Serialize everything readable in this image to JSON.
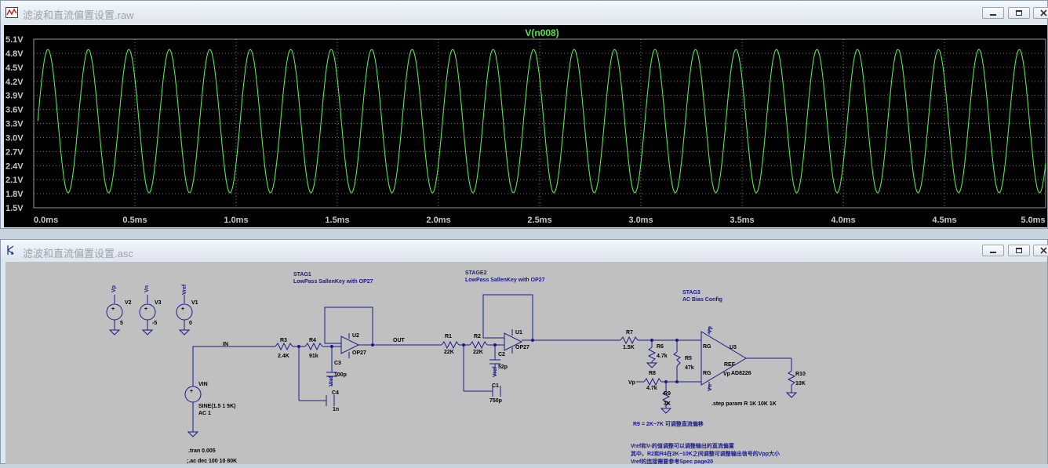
{
  "plot_window": {
    "title": "滤波和直流偏置设置.raw"
  },
  "schematic_window": {
    "title": "滤波和直流偏置设置.asc"
  },
  "chart_data": {
    "type": "line",
    "title": "V(n008)",
    "xlabel": "",
    "ylabel": "",
    "xlim": [
      0,
      5.0
    ],
    "ylim": [
      1.5,
      5.1
    ],
    "x_ticks": [
      "0.0ms",
      "0.5ms",
      "1.0ms",
      "1.5ms",
      "2.0ms",
      "2.5ms",
      "3.0ms",
      "3.5ms",
      "4.0ms",
      "4.5ms",
      "5.0ms"
    ],
    "y_ticks": [
      "5.1V",
      "4.8V",
      "4.5V",
      "4.2V",
      "3.9V",
      "3.6V",
      "3.3V",
      "3.0V",
      "2.7V",
      "2.4V",
      "2.1V",
      "1.8V",
      "1.5V"
    ],
    "grid": true,
    "series": [
      {
        "name": "V(n008)",
        "color": "#55e655",
        "frequency_khz": 5,
        "offset_v": 3.35,
        "amplitude_v": 1.53,
        "x_start_ms": 0.02,
        "x_end_ms": 5.0
      }
    ]
  },
  "schematic": {
    "sources": [
      {
        "ref": "V2",
        "net": "Vp",
        "value": "5"
      },
      {
        "ref": "V3",
        "net": "Vn",
        "value": "-5"
      },
      {
        "ref": "V1",
        "net": "Vref",
        "value": "0"
      }
    ],
    "vin": {
      "ref": "VIN",
      "value": "SINE(1.5 1 5K)",
      "ac": "AC 1"
    },
    "nets": {
      "in": "IN",
      "out": "OUT",
      "vp": "Vp",
      "vn": "Vn",
      "vref": "Vref"
    },
    "stage1": {
      "title": "STAG1",
      "subtitle": "LowPass SallenKey with OP27",
      "r3": {
        "ref": "R3",
        "value": "2.4K"
      },
      "r4": {
        "ref": "R4",
        "value": "91k"
      },
      "c3": {
        "ref": "C3",
        "value": "100p"
      },
      "c4": {
        "ref": "C4",
        "value": "1n"
      },
      "opamp": {
        "ref": "U2",
        "model": "OP27"
      }
    },
    "stage2": {
      "title": "STAGE2",
      "subtitle": "LowPass SallenKey with OP27",
      "r1": {
        "ref": "R1",
        "value": "22K"
      },
      "r2": {
        "ref": "R2",
        "value": "22K"
      },
      "c2": {
        "ref": "C2",
        "value": "52p"
      },
      "c1": {
        "ref": "C1",
        "value": "750p"
      },
      "opamp": {
        "ref": "U1",
        "model": "OP27"
      }
    },
    "stage3": {
      "title": "STAG3",
      "subtitle": "AC Bias Config",
      "r7": {
        "ref": "R7",
        "value": "1.5K"
      },
      "r6": {
        "ref": "R6",
        "value": "4.7k"
      },
      "r5": {
        "ref": "R5",
        "value": "47k"
      },
      "r8": {
        "ref": "R8",
        "value": "4.7k"
      },
      "r9": {
        "ref": "R9",
        "value": "3K"
      },
      "r10": {
        "ref": "R10",
        "value": "10K"
      },
      "amp": {
        "ref": "U3",
        "model": "AD8226",
        "pin_rg": "RG",
        "pin_ref": "REF"
      }
    },
    "directives": {
      "step": ".step param R 1K 10K 1K",
      "tran": ".tran 0.005",
      "ac": ";.ac dec 100 10 80K"
    },
    "notes": {
      "r9_note": "R9 = 2K~7K 可调整直流偏移",
      "line1": "Vref和V-的值调整可以调整输出的直流偏置",
      "line2": "其中，R2和R4在2K~10K之间调整可调整输出信号的Vpp大小",
      "line3": "Vref的连接需要参考Spec page20"
    }
  }
}
